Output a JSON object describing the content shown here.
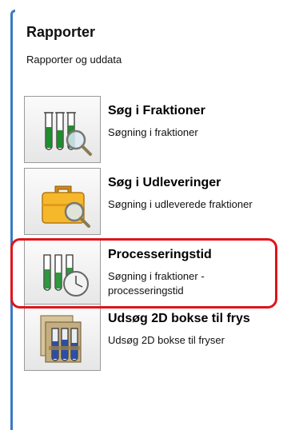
{
  "panel": {
    "title": "Rapporter",
    "subtitle": "Rapporter og uddata"
  },
  "items": [
    {
      "title": "Søg i Fraktioner",
      "description": "Søgning i fraktioner",
      "icon": "tubes-magnifier-icon"
    },
    {
      "title": "Søg i Udleveringer",
      "description": "Søgning i udleverede fraktioner",
      "icon": "briefcase-magnifier-icon"
    },
    {
      "title": "Processeringstid",
      "description": "Søgning i fraktioner - processeringstid",
      "icon": "tubes-clock-icon"
    },
    {
      "title": "Udsøg 2D bokse til frys",
      "description": "Udsøg 2D bokse til fryser",
      "icon": "tube-rack-icon"
    }
  ],
  "colors": {
    "accent_border": "#3b78c8",
    "highlight": "#e0141b"
  }
}
